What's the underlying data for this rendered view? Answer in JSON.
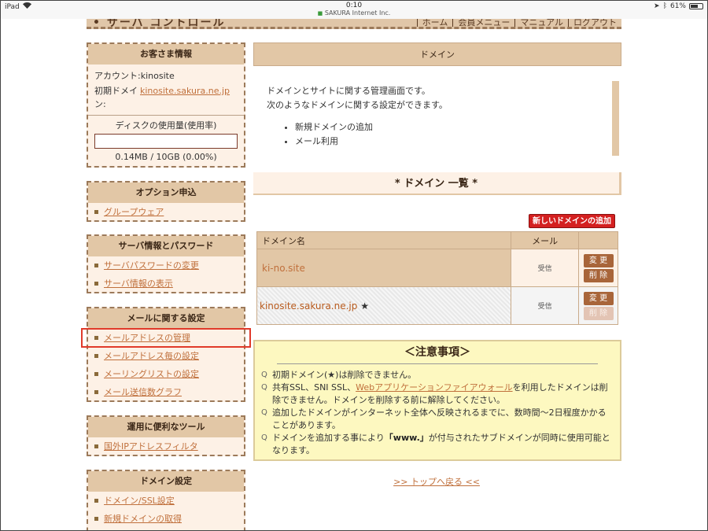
{
  "statusbar": {
    "device": "iPad",
    "time": "0:10",
    "site": "SAKURA Internet Inc.",
    "battery": "61%",
    "battery_level": 0.61
  },
  "header": {
    "logo_fragment": "• サーバ コントロール",
    "nav": [
      "ホーム",
      "会員メニュー",
      "マニュアル",
      "ログアウト"
    ]
  },
  "sidebar": {
    "customer": {
      "title": "お客さま情報",
      "account_label": "アカウント:",
      "account_value": "kinosite",
      "domain_label": "初期ドメイン:",
      "domain_value": "kinosite.sakura.ne.jp",
      "disk_label": "ディスクの使用量(使用率)",
      "disk_value": "0.14MB / 10GB (0.00%)",
      "disk_fraction": 0.0
    },
    "option": {
      "title": "オプション申込",
      "items": [
        "グループウェア"
      ]
    },
    "server": {
      "title": "サーバ情報とパスワード",
      "items": [
        "サーバパスワードの変更",
        "サーバ情報の表示"
      ]
    },
    "mail": {
      "title": "メールに関する設定",
      "items": [
        "メールアドレスの管理",
        "メールアドレス毎の設定",
        "メーリングリストの設定",
        "メール送信数グラフ"
      ]
    },
    "tools": {
      "title": "運用に便利なツール",
      "items": [
        "国外IPアドレスフィルタ"
      ]
    },
    "domain": {
      "title": "ドメイン設定",
      "items": [
        "ドメイン/SSL設定",
        "新規ドメインの取得"
      ]
    }
  },
  "main": {
    "title": "ドメイン",
    "intro_line1": "ドメインとサイトに関する管理画面です。",
    "intro_line2": "次のようなドメインに関する設定ができます。",
    "intro_items": [
      "新規ドメインの追加",
      "メール利用"
    ],
    "list_title": "* ドメイン 一覧 *",
    "add_button": "新しいドメインの追加",
    "table": {
      "col_domain": "ドメイン名",
      "col_mail": "メール",
      "rows": [
        {
          "domain": "ki-no.site",
          "mark": "",
          "mail": "受信",
          "edit": "変 更",
          "delete": "削 除"
        },
        {
          "domain": "kinosite.sakura.ne.jp",
          "mark": "★",
          "mail": "受信",
          "edit": "変 更",
          "delete": "削 除"
        }
      ]
    },
    "notes": {
      "title": "＜注意事項＞",
      "n1": "初期ドメイン(★)は削除できません。",
      "n2_pre": "共有SSL、SNI SSL、",
      "n2_link": "Webアプリケーションファイアウォール",
      "n2_post": "を利用したドメインは削除できません。ドメインを削除する前に解除してください。",
      "n3": "追加したドメインがインターネット全体へ反映されるまでに、数時間〜2日程度かかることがあります。",
      "n4_pre": "ドメインを追加する事により",
      "n4_bold": "「www.」",
      "n4_post": "が付与されたサブドメインが同時に使用可能となります。"
    },
    "top_link": ">> トップへ戻る <<"
  }
}
